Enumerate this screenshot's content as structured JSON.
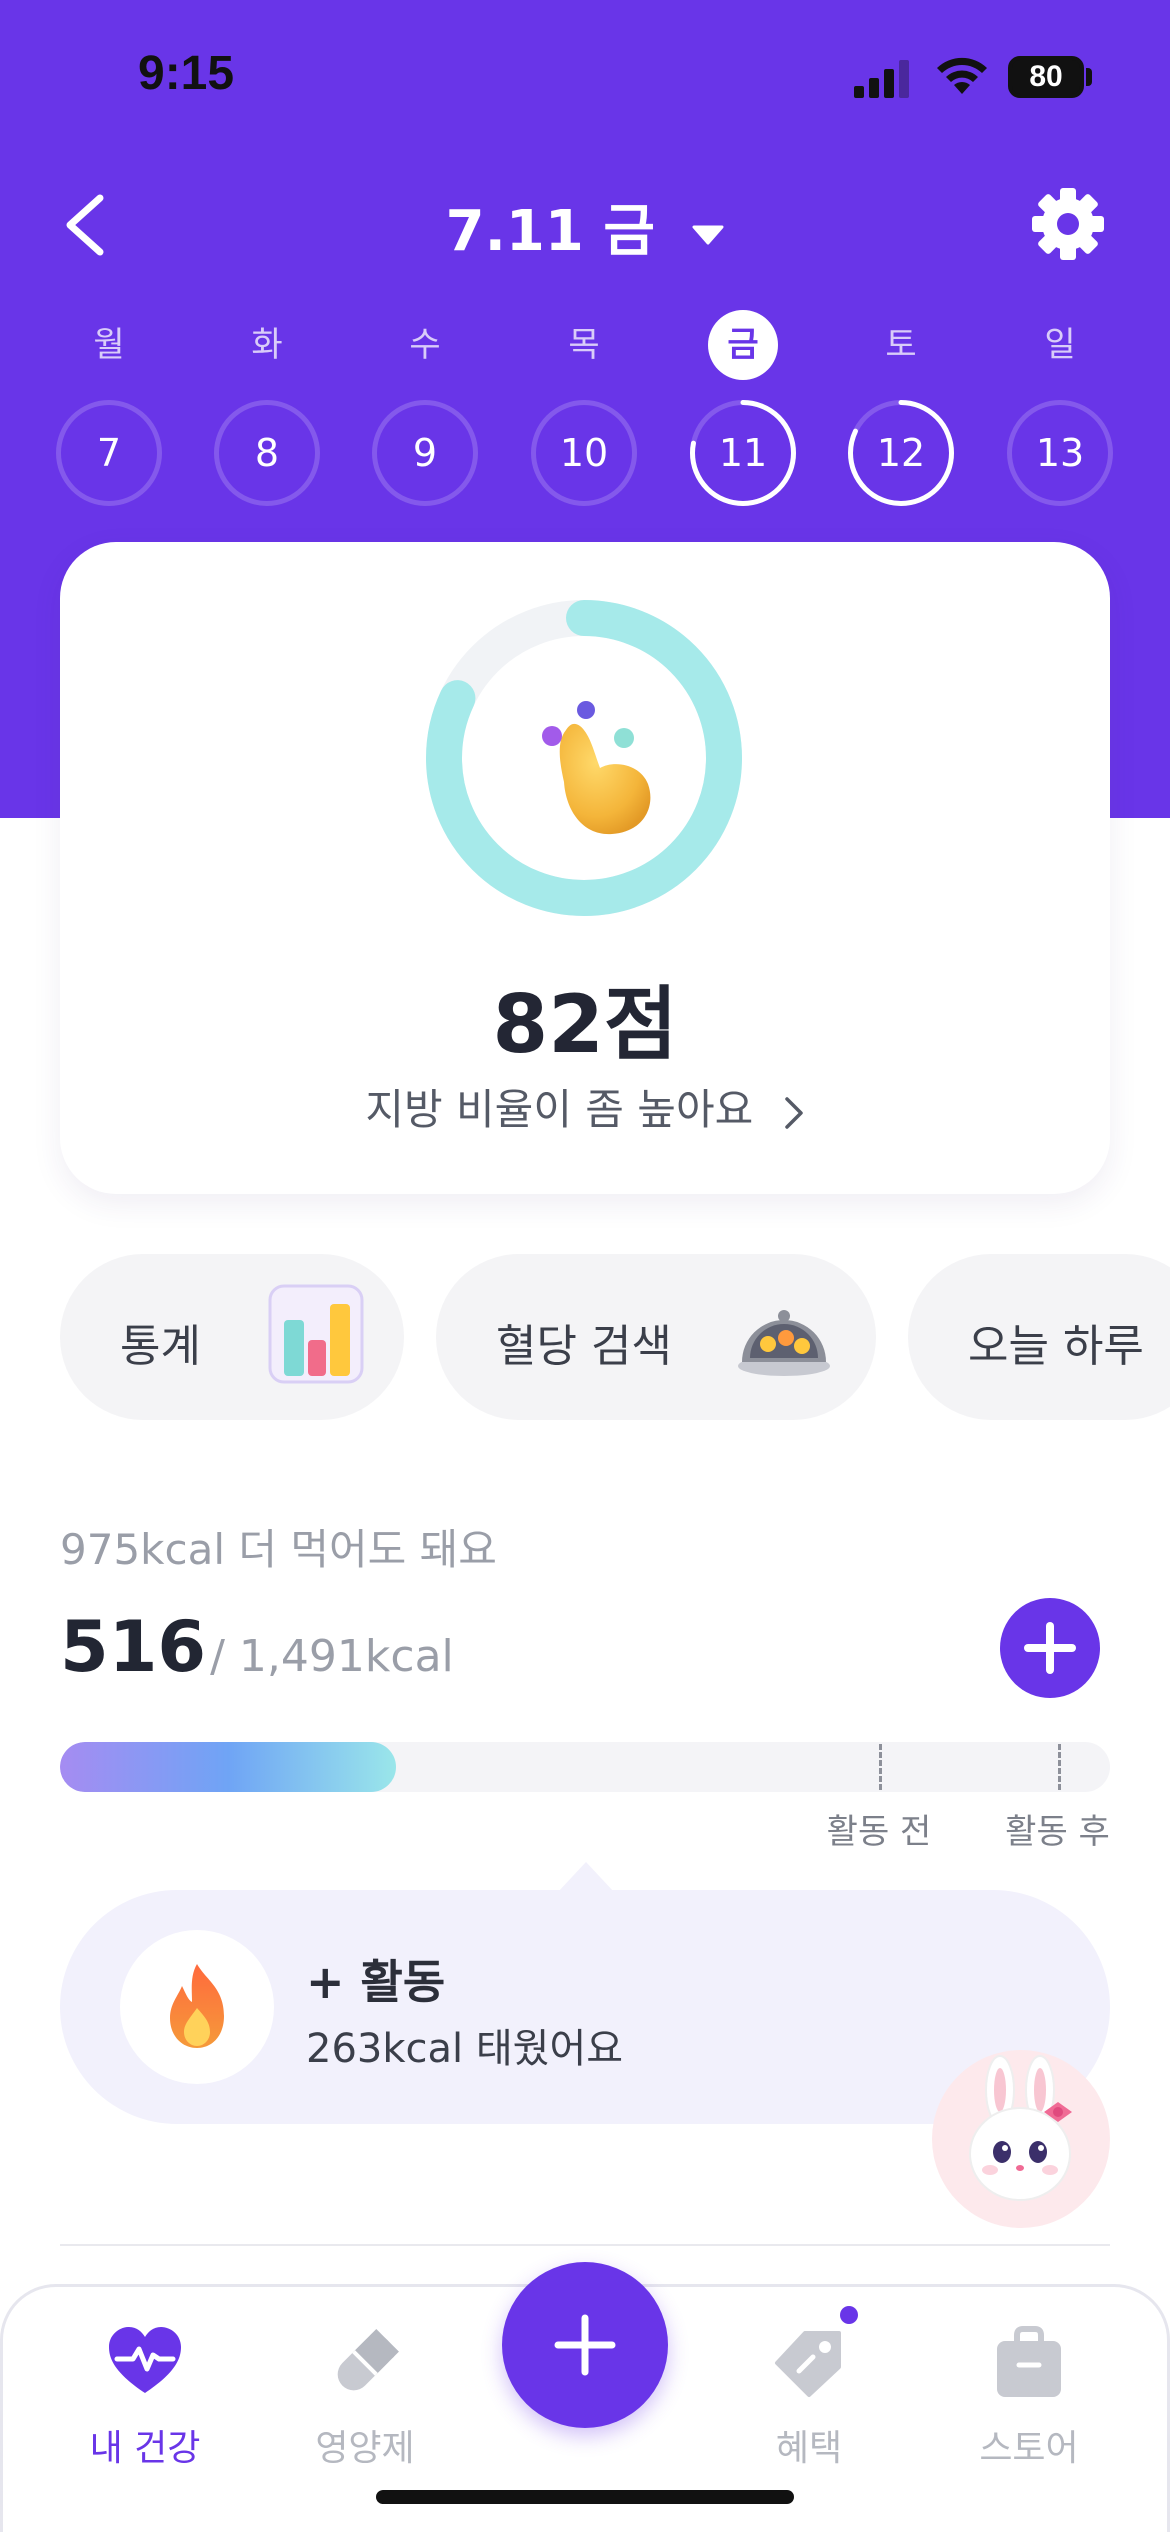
{
  "status_bar": {
    "time": "9:15",
    "battery": "80"
  },
  "header": {
    "date_title": "7.11 금"
  },
  "week": [
    {
      "name": "월",
      "date": "7",
      "progress": 0,
      "active": false
    },
    {
      "name": "화",
      "date": "8",
      "progress": 0,
      "active": false
    },
    {
      "name": "수",
      "date": "9",
      "progress": 0,
      "active": false
    },
    {
      "name": "목",
      "date": "10",
      "progress": 0,
      "active": false
    },
    {
      "name": "금",
      "date": "11",
      "progress": 0.78,
      "active": true
    },
    {
      "name": "토",
      "date": "12",
      "progress": 0.82,
      "active": false
    },
    {
      "name": "일",
      "date": "13",
      "progress": 0,
      "active": false
    }
  ],
  "score_card": {
    "score": "82점",
    "score_percent": 82,
    "description": "지방 비율이 좀 높아요"
  },
  "chips": [
    {
      "label": "통계",
      "icon": "bar-chart-icon"
    },
    {
      "label": "혈당 검색",
      "icon": "food-cloche-icon"
    },
    {
      "label": "오늘 하루",
      "icon": ""
    }
  ],
  "calories": {
    "remaining_text": "975kcal 더 먹어도 돼요",
    "current": "516",
    "total": "/ 1,491kcal",
    "progress_fraction": 0.32,
    "markers": [
      {
        "label": "활동 전",
        "fraction": 0.78
      },
      {
        "label": "활동 후",
        "fraction": 0.95
      }
    ]
  },
  "activity": {
    "title": "+ 활동",
    "subtitle": "263kcal 태웠어요",
    "icon": "fire-icon"
  },
  "tab_bar": [
    {
      "label": "내 건강",
      "icon": "heart-pulse-icon",
      "active": true
    },
    {
      "label": "영양제",
      "icon": "pill-icon",
      "active": false
    },
    {
      "label": "혜택",
      "icon": "tag-icon",
      "active": false
    },
    {
      "label": "스토어",
      "icon": "bag-icon",
      "active": false
    }
  ],
  "colors": {
    "primary": "#6935e8",
    "ring": "#a6eaea",
    "progress_start": "#a58cf2",
    "progress_end": "#9ae6ea"
  }
}
